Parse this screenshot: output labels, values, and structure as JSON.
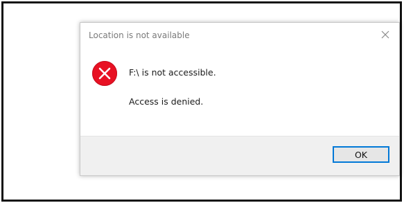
{
  "dialog": {
    "title": "Location is not available",
    "message": "F:\\ is not accessible.",
    "detail": "Access is denied.",
    "ok_label": "OK",
    "close_icon": "close-icon",
    "error_icon": "error-icon"
  },
  "colors": {
    "error_red": "#e81123",
    "button_accent": "#0078d7",
    "footer_bg": "#f0f0f0",
    "title_text": "#7a7a7a"
  }
}
